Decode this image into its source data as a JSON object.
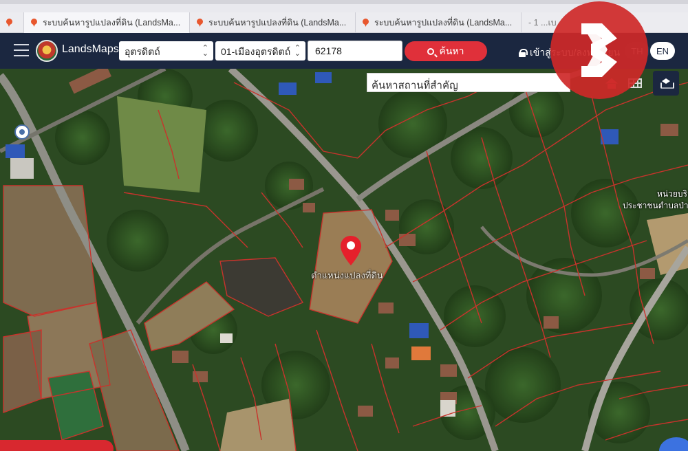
{
  "browser": {
    "tabs": [
      {
        "label": "ระบบค้นหารูปแปลงที่ดิน (LandsMa..."
      },
      {
        "label": "ระบบค้นหารูปแปลงที่ดิน (LandsMa..."
      },
      {
        "label": "ระบบค้นหารูปแปลงที่ดิน (LandsMa..."
      },
      {
        "label": "- 1 ...เบ"
      }
    ]
  },
  "navbar": {
    "brand": "LandsMaps",
    "province": "อุตรดิตถ์",
    "district": "01-เมืองอุตรดิตถ์",
    "parcel_number": "62178",
    "search_label": "ค้นหา",
    "login_label": "เข้าสู่ระบบ/ลงทะเบียน",
    "lang_th": "TH",
    "lang_en": "EN"
  },
  "map": {
    "place_search_placeholder": "ค้นหาสถานที่สำคัญ",
    "parcel_label": "ตำแหน่งแปลงที่ดิน",
    "place_label_1": "หน่วยบริการ",
    "place_label_2": "ประชาชนตำบลป่า"
  },
  "colors": {
    "navbar_bg": "#1b2740",
    "search_button": "#e0303a",
    "parcel_boundary": "#c8332c",
    "watermark": "#ce2828"
  },
  "icons": [
    "menu-icon",
    "search-icon",
    "lock-icon",
    "home-icon",
    "grid-icon",
    "layers-icon",
    "map-pin-icon",
    "watermark-logo"
  ]
}
